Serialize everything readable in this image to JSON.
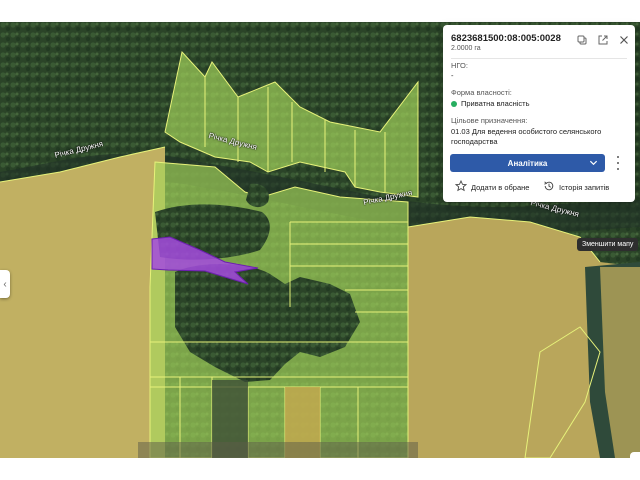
{
  "map": {
    "river_labels": [
      {
        "text": "Річка Дружня"
      },
      {
        "text": "Річка Дружня"
      },
      {
        "text": "Річка Дружня"
      },
      {
        "text": "Річка Дружня"
      }
    ],
    "zoom_out_tooltip": "Зменшити мапу",
    "highlight_color": "#a54adf"
  },
  "parcel_card": {
    "cadastral_number": "6823681500:08:005:0028",
    "area": "2.0000 га",
    "ngo_label": "НГО:",
    "ngo_value": "-",
    "ownership_label": "Форма власності:",
    "ownership_value": "Приватна власність",
    "ownership_status_color": "#27ae60",
    "purpose_label": "Цільове призначення:",
    "purpose_value_line1": "01.03 Для ведення особистого селянського",
    "purpose_value_line2": "господарства",
    "analytics_label": "Аналітика",
    "favorite_label": "Додати в обране",
    "history_label": "Історія запитів",
    "icons": [
      "copy-icon",
      "external-link-icon",
      "close-icon"
    ]
  }
}
